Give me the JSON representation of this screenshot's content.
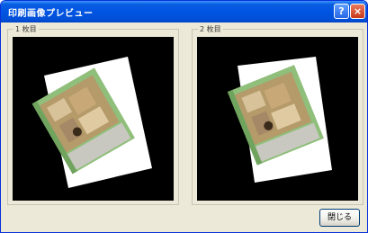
{
  "window": {
    "title": "印刷画像プレビュー"
  },
  "titlebar": {
    "help_glyph": "?",
    "close_glyph": "×"
  },
  "pages": [
    {
      "label": "1 枚目"
    },
    {
      "label": "2 枚目"
    }
  ],
  "footer": {
    "close_label": "閉じる"
  },
  "colors": {
    "titlebar": "#0054e3",
    "dialog_bg": "#ece9d8",
    "preview_bg": "#000000",
    "paper": "#ffffff",
    "map_green": "#6fa35e"
  },
  "icons": {
    "help": "help-icon",
    "close": "close-icon"
  }
}
